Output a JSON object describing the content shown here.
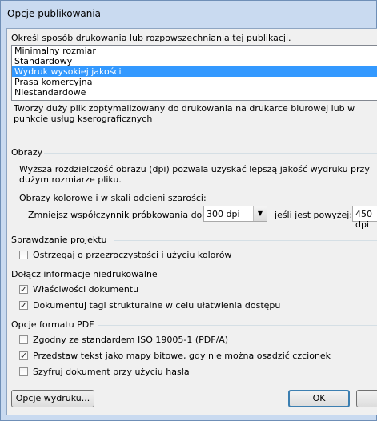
{
  "window": {
    "title": "Opcje publikowania"
  },
  "print_mode": {
    "label": "Określ sposób drukowania lub rozpowszechniania tej publikacji.",
    "options": [
      "Minimalny rozmiar",
      "Standardowy",
      "Wydruk wysokiej jakości",
      "Prasa komercyjna",
      "Niestandardowe"
    ],
    "selected": "Wydruk wysokiej jakości",
    "description": "Tworzy duży plik zoptymalizowany do drukowania na drukarce biurowej lub w punkcie usług kserograficznych"
  },
  "images": {
    "heading": "Obrazy",
    "description": "Wyższa rozdzielczość obrazu (dpi) pozwala uzyskać lepszą jakość wydruku przy dużym rozmiarze pliku.",
    "color_label": "Obrazy kolorowe i w skali odcieni szarości:",
    "downsample_label": "Zmniejsz współczynnik próbkowania do:",
    "downsample_value": "300 dpi",
    "if_above_label": "jeśli jest powyżej:",
    "if_above_value": "450 dpi"
  },
  "check_project": {
    "heading": "Sprawdzanie projektu",
    "warn_transparency": {
      "label": "Ostrzegaj o przezroczystości i użyciu kolorów",
      "checked": false
    }
  },
  "non_print_info": {
    "heading": "Dołącz informacje niedrukowalne",
    "doc_properties": {
      "label": "Właściwości dokumentu",
      "checked": true
    },
    "doc_tags": {
      "label": "Dokumentuj tagi strukturalne w celu ułatwienia dostępu",
      "checked": true
    }
  },
  "pdf_options": {
    "heading": "Opcje formatu PDF",
    "iso": {
      "label": "Zgodny ze standardem ISO 19005-1 (PDF/A)",
      "checked": false
    },
    "bitmap_text": {
      "label": "Przedstaw tekst jako mapy bitowe, gdy nie można osadzić czcionek",
      "checked": true
    },
    "encrypt": {
      "label": "Szyfruj dokument przy użyciu hasła",
      "checked": false
    }
  },
  "buttons": {
    "print_options": "Opcje wydruku...",
    "ok": "OK"
  },
  "colors": {
    "selection": "#3399ff",
    "dialog_bg": "#f0f0f0",
    "frame": "#c9daf0"
  }
}
